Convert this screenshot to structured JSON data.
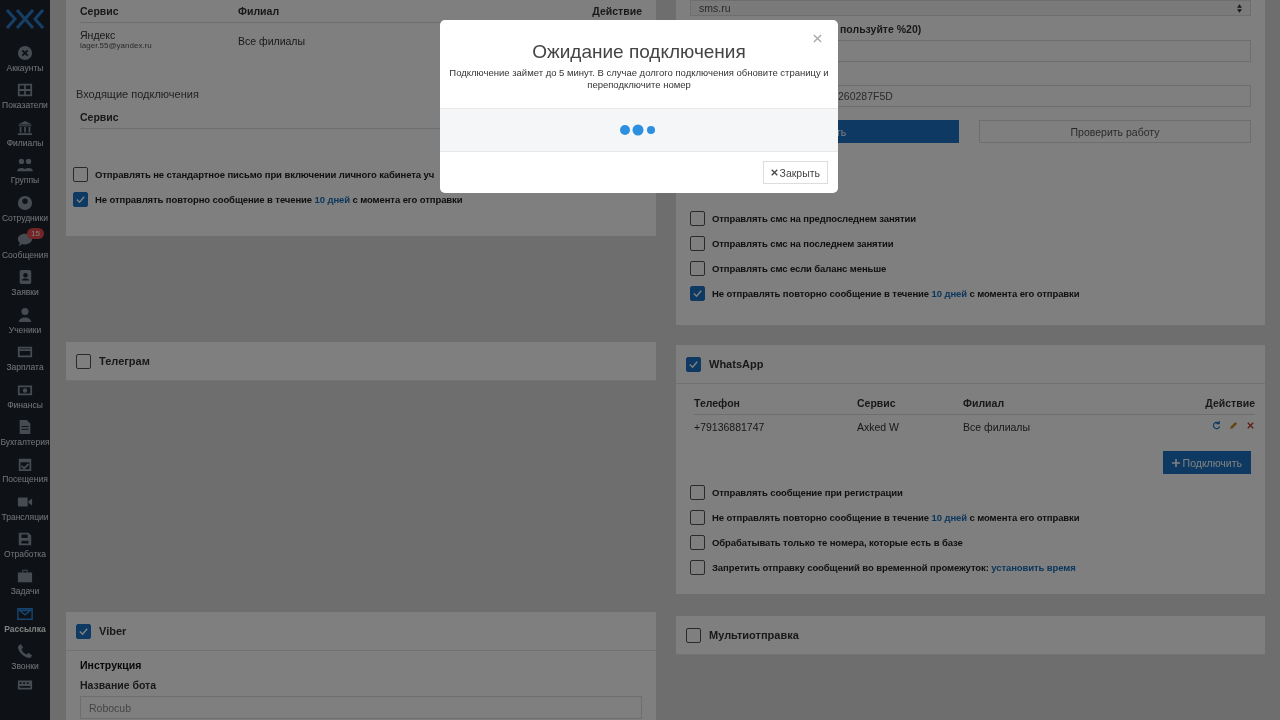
{
  "sidebar": {
    "items": [
      {
        "label": "Аккаунты",
        "selected": false
      },
      {
        "label": "Показатели",
        "selected": false
      },
      {
        "label": "Филиалы",
        "selected": false
      },
      {
        "label": "Группы",
        "selected": false
      },
      {
        "label": "Сотрудники",
        "selected": false
      },
      {
        "label": "Сообщения",
        "selected": false,
        "badge": "15"
      },
      {
        "label": "Заявки",
        "selected": false
      },
      {
        "label": "Ученики",
        "selected": false
      },
      {
        "label": "Зарплата",
        "selected": false
      },
      {
        "label": "Финансы",
        "selected": false
      },
      {
        "label": "Бухгалтерия",
        "selected": false
      },
      {
        "label": "Посещения",
        "selected": false
      },
      {
        "label": "Трансляции",
        "selected": false
      },
      {
        "label": "Отработка",
        "selected": false
      },
      {
        "label": "Задачи",
        "selected": false
      },
      {
        "label": "Рассылка",
        "selected": true
      },
      {
        "label": "Звонки",
        "selected": false
      }
    ]
  },
  "email_card": {
    "columns": [
      "Сервис",
      "Филиал",
      "Действие"
    ],
    "rows": [
      {
        "service": "Яндекс",
        "email": "lager.55@yandex.ru",
        "branch": "Все филиалы"
      }
    ],
    "incoming_title": "Входящие подключения",
    "incoming_columns": [
      "Сервис"
    ],
    "options": [
      {
        "text": "Отправлять не стандартное письмо при включении личного кабинета уч",
        "checked": false
      },
      {
        "text": "Не отправлять повторно сообщение в течение ",
        "link": "10 дней",
        "after": " с момента его отправки",
        "checked": true
      }
    ]
  },
  "telegram": {
    "title": "Телеграм",
    "checked": false
  },
  "viber": {
    "title": "Viber",
    "checked": true,
    "instruction": "Инструкция",
    "bot_label": "Название бота",
    "bot_name": "Robocub"
  },
  "sms_card": {
    "provider": "sms.ru",
    "label_fragment": "пользуйте %20)",
    "key_fragment": "260287F5D",
    "primary_fragment": "ть",
    "check_button": "Проверить работу",
    "options": [
      {
        "text": "Отправлять смс на предпоследнем занятии",
        "checked": false
      },
      {
        "text": "Отправлять смс на последнем занятии",
        "checked": false
      },
      {
        "text": "Отправлять смс если баланс меньше",
        "checked": false
      },
      {
        "text": "Не отправлять повторно сообщение в течение ",
        "link": "10 дней",
        "after": " с момента его отправки",
        "checked": true
      }
    ]
  },
  "whatsapp": {
    "title": "WhatsApp",
    "checked": true,
    "columns": [
      "Телефон",
      "Сервис",
      "Филиал",
      "Действие"
    ],
    "rows": [
      {
        "phone": "+79136881747",
        "service": "Axked W",
        "branch": "Все филиалы"
      }
    ],
    "connect_button": "Подключить",
    "options": [
      {
        "text": "Отправлять сообщение при регистрации",
        "checked": false
      },
      {
        "text": "Не отправлять повторно сообщение в течение ",
        "link": "10 дней",
        "after": " с момента его отправки",
        "checked": false
      },
      {
        "text": "Обрабатывать только те номера, которые есть в базе",
        "checked": false
      },
      {
        "text": "Запретить отправку сообщений во временной промежуток: ",
        "link": "установить время",
        "checked": false
      }
    ]
  },
  "multi": {
    "title": "Мультиотправка",
    "checked": false
  },
  "modal": {
    "title": "Ожидание подключения",
    "message": "Подключение займет до 5 минут. В случае долгого подключения обновите страницу и переподключите номер",
    "close_button": "Закрыть"
  }
}
